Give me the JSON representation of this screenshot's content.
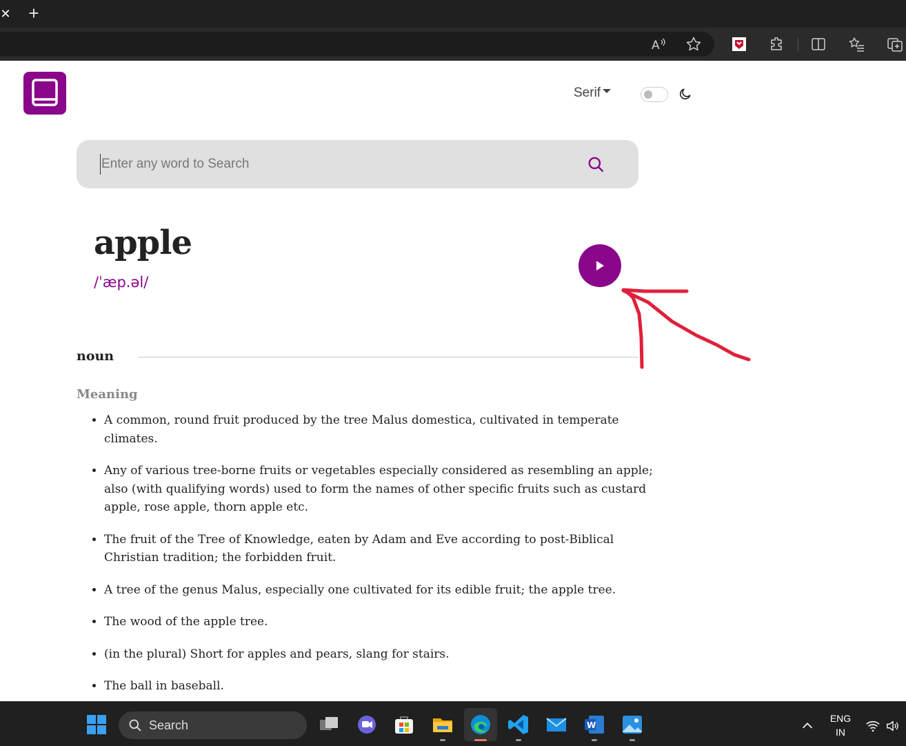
{
  "browser": {
    "new_tab_label": "+",
    "close_tab_label": "✕"
  },
  "app": {
    "font_selector": "Serif",
    "theme_toggle_on": false
  },
  "search": {
    "placeholder": "Enter any word to Search",
    "value": ""
  },
  "entry": {
    "word": "apple",
    "phonetic": "/ˈæp.əl/",
    "part_of_speech": "noun",
    "meaning_heading": "Meaning",
    "definitions": [
      "A common, round fruit produced by the tree Malus domestica, cultivated in temperate climates.",
      "Any of various tree-borne fruits or vegetables especially considered as resembling an apple; also (with qualifying words) used to form the names of other specific fruits such as custard apple, rose apple, thorn apple etc.",
      "The fruit of the Tree of Knowledge, eaten by Adam and Eve according to post-Biblical Christian tradition; the forbidden fruit.",
      "A tree of the genus Malus, especially one cultivated for its edible fruit; the apple tree.",
      "The wood of the apple tree.",
      "(in the plural) Short for apples and pears, slang for stairs.",
      "The ball in baseball."
    ]
  },
  "taskbar": {
    "search_label": "Search",
    "lang_line1": "ENG",
    "lang_line2": "IN"
  },
  "colors": {
    "accent": "#8a068a",
    "annotation": "#e0203a"
  }
}
